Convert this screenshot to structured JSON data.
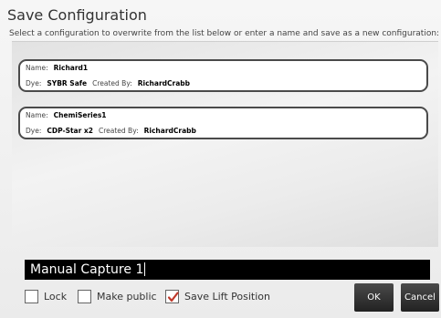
{
  "dialog": {
    "title": "Save Configuration",
    "instructions": "Select a configuration to overwrite from the list below or enter a name and save as a new configuration:"
  },
  "configs": [
    {
      "name_label": "Name:",
      "name": "Richard1",
      "dye_label": "Dye:",
      "dye": "SYBR Safe",
      "created_label": "Created By:",
      "created_by": "RichardCrabb"
    },
    {
      "name_label": "Name:",
      "name": "ChemiSeries1",
      "dye_label": "Dye:",
      "dye": "CDP-Star x2",
      "created_label": "Created By:",
      "created_by": "RichardCrabb"
    }
  ],
  "name_input": {
    "value": "Manual Capture 1"
  },
  "options": {
    "lock": {
      "label": "Lock",
      "checked": false
    },
    "make_public": {
      "label": "Make public",
      "checked": false
    },
    "save_lift": {
      "label": "Save Lift Position",
      "checked": true
    }
  },
  "buttons": {
    "ok": "OK",
    "cancel": "Cancel"
  },
  "colors": {
    "check_mark": "#c0392b",
    "input_background": "#000000",
    "button_background": "#333333",
    "item_border": "#4a4a4a"
  }
}
